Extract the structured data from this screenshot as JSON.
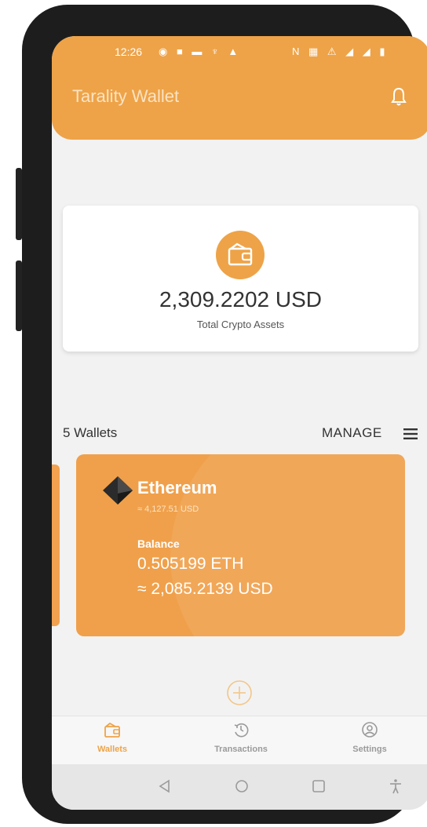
{
  "status_bar": {
    "time": "12:26",
    "left_icons": "◉ ■ ▬ ♆ ▲",
    "right_icons": "N ▦ ⚠ ◢ ◢ ▮"
  },
  "header": {
    "title": "Tarality Wallet"
  },
  "summary": {
    "total_amount": "2,309.2202 USD",
    "caption": "Total Crypto Assets"
  },
  "wallets": {
    "count_label": "5 Wallets",
    "manage_label": "MANAGE"
  },
  "wallet_card": {
    "name": "Ethereum",
    "rate": "≈ 4,127.51 USD",
    "balance_label": "Balance",
    "balance_crypto": "0.505199 ETH",
    "balance_usd": "≈ 2,085.2139 USD"
  },
  "bottom_nav": {
    "items": [
      {
        "label": "Wallets",
        "icon": "wallet-icon",
        "active": true
      },
      {
        "label": "Transactions",
        "icon": "history-icon",
        "active": false
      },
      {
        "label": "Settings",
        "icon": "user-circle-icon",
        "active": false
      }
    ]
  },
  "colors": {
    "accent": "#eea348",
    "card": "#f0a04a",
    "inactive": "#9a9a9a"
  }
}
